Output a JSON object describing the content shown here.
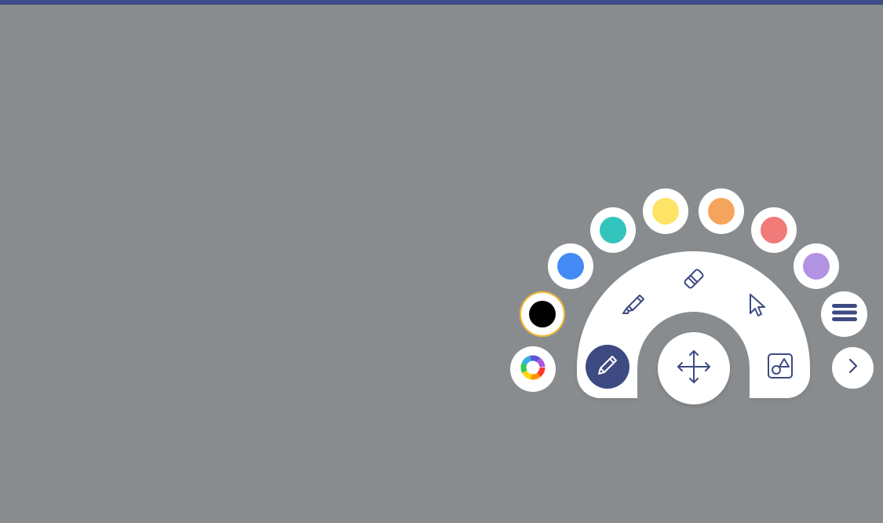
{
  "palette": {
    "selected_color": "#000000",
    "colors": [
      {
        "name": "black",
        "hex": "#000000"
      },
      {
        "name": "blue",
        "hex": "#448af5"
      },
      {
        "name": "teal",
        "hex": "#34c4be"
      },
      {
        "name": "yellow",
        "hex": "#fde466"
      },
      {
        "name": "orange",
        "hex": "#f5a45d"
      },
      {
        "name": "red",
        "hex": "#f07b78"
      },
      {
        "name": "purple",
        "hex": "#b292e2"
      }
    ]
  },
  "tools": [
    {
      "name": "pencil",
      "active": true
    },
    {
      "name": "highlighter",
      "active": false
    },
    {
      "name": "eraser",
      "active": false
    },
    {
      "name": "pointer",
      "active": false
    },
    {
      "name": "shapes",
      "active": false
    },
    {
      "name": "move",
      "active": false
    }
  ],
  "accent_color": "#3e4a82",
  "icons": [
    "color-wheel-icon",
    "pencil-icon",
    "highlighter-icon",
    "eraser-icon",
    "pointer-icon",
    "shapes-icon",
    "move-icon",
    "menu-icon",
    "chevron-right-icon"
  ]
}
